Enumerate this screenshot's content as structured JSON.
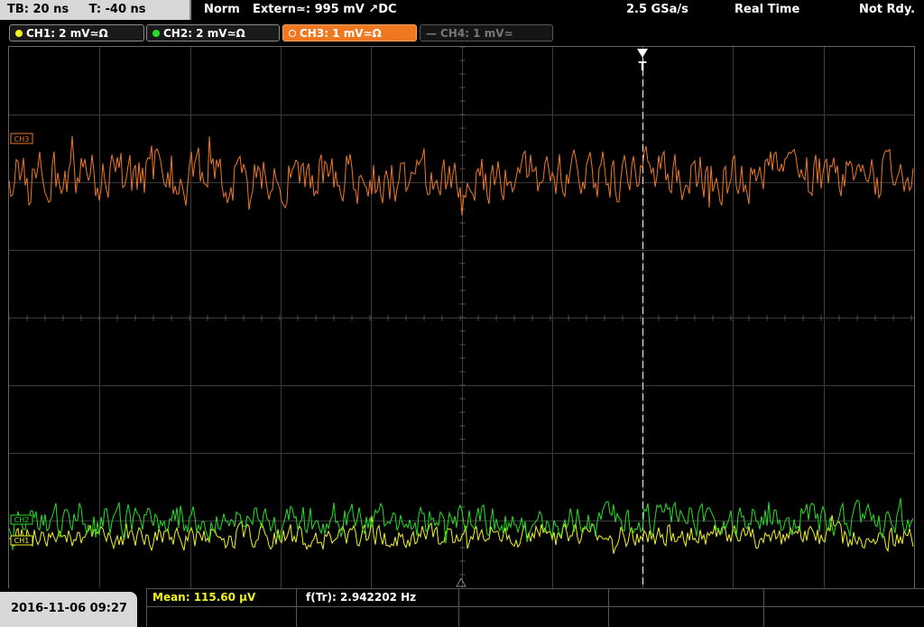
{
  "topbar": {
    "timebase": "TB: 20 ns",
    "trigger_pos": "T: -40 ns",
    "trigger_mode": "Norm",
    "trigger_source": "Extern≃: 995 mV ↗DC",
    "sample_rate": "2.5 GSa/s",
    "acq_mode": "Real Time",
    "status": "Not Rdy."
  },
  "channels": [
    {
      "label": "CH1: 2 mV≃Ω",
      "color": "#f2f21e",
      "state": "on"
    },
    {
      "label": "CH2: 2 mV≃Ω",
      "color": "#22e022",
      "state": "on"
    },
    {
      "label": "CH3: 1 mV≃Ω",
      "color": "#f07820",
      "state": "active"
    },
    {
      "label": "CH4: 1 mV≃",
      "color": "#777777",
      "state": "off"
    }
  ],
  "markers": {
    "trigger_marker": "T",
    "ch3_marker": "CH3",
    "ch2_marker": "CH2",
    "ch1_marker": "CH1"
  },
  "waveforms": {
    "ch3": {
      "color": "#f07820",
      "level": 0.24,
      "amplitude": 0.045
    },
    "ch2": {
      "color": "#22e022",
      "level": 0.875,
      "amplitude": 0.03
    },
    "ch1": {
      "color": "#f2f21e",
      "level": 0.905,
      "amplitude": 0.022
    }
  },
  "measurements": {
    "mean": "Mean: 115.60 µV",
    "mean_color": "#f2f21e",
    "freq": "f(Tr): 2.942202 Hz"
  },
  "datetime": "2016-11-06 09:27"
}
